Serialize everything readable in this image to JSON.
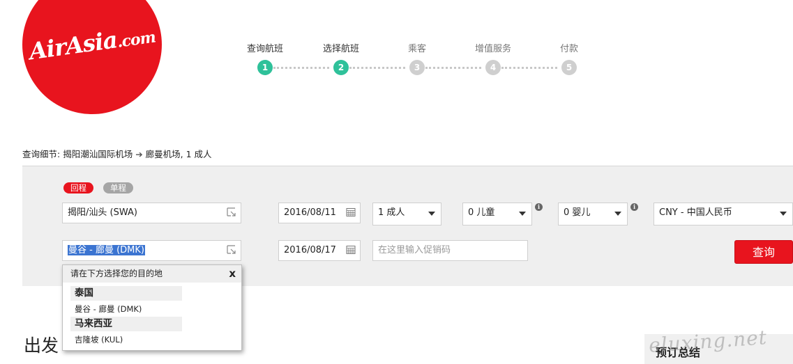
{
  "logo": {
    "brand": "AirAsia",
    "suffix": ".com",
    "color": "#e8141e"
  },
  "steps": [
    {
      "label": "查询航班",
      "number": "1",
      "state": "active"
    },
    {
      "label": "选择航班",
      "number": "2",
      "state": "active"
    },
    {
      "label": "乘客",
      "number": "3",
      "state": "inactive"
    },
    {
      "label": "增值服务",
      "number": "4",
      "state": "inactive"
    },
    {
      "label": "付款",
      "number": "5",
      "state": "inactive"
    }
  ],
  "summary": {
    "prefix": "查询细节:",
    "origin": "揭阳潮汕国际机场",
    "arrow": "➔",
    "destination_and_pax": "廊曼机场, 1 成人"
  },
  "trip_type": {
    "return_label": "回程",
    "oneway_label": "单程"
  },
  "form": {
    "origin_value": "揭阳/汕头 (SWA)",
    "destination_value": "曼谷 - 廊曼 (DMK)",
    "depart_date": "2016/08/11",
    "return_date": "2016/08/17",
    "adults": "1 成人",
    "children": "0 儿童",
    "infants": "0 婴儿",
    "currency": "CNY - 中国人民币",
    "promo_placeholder": "在这里输入促销码",
    "search_label": "查询",
    "info_symbol": "i"
  },
  "dropdown": {
    "header": "请在下方选择您的目的地",
    "close": "x",
    "groups": [
      {
        "country": "泰国",
        "airports": [
          "曼谷 - 廊曼 (DMK)"
        ]
      },
      {
        "country": "马来西亚",
        "airports": [
          "吉隆坡 (KUL)"
        ]
      }
    ]
  },
  "section": {
    "depart_heading": "出发"
  },
  "booking": {
    "title": "预订总结"
  },
  "watermark": "eluxing.net",
  "colors": {
    "accent_red": "#e8141e",
    "step_active": "#2fc19a",
    "step_inactive": "#cfcfcf",
    "panel_bg": "#efefef"
  }
}
